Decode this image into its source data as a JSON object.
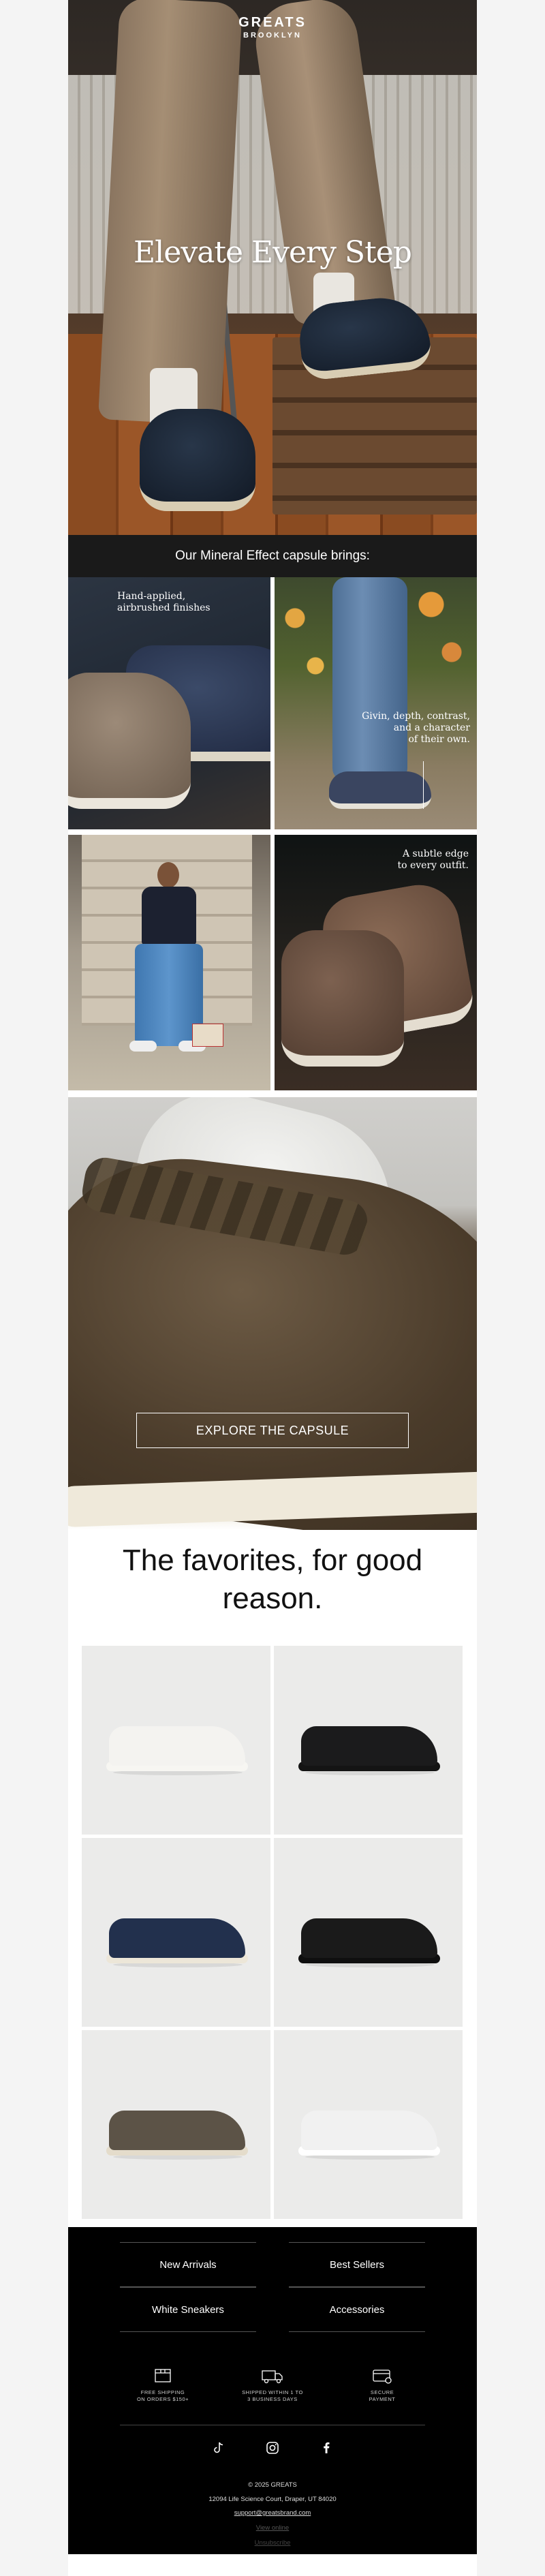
{
  "brand": {
    "line1": "GREATS",
    "line2": "BROOKLYN"
  },
  "hero": {
    "headline": "Elevate Every Step"
  },
  "capsule": {
    "intro": "Our Mineral Effect capsule brings:",
    "cards": [
      {
        "caption_line1": "Hand-applied,",
        "caption_line2": "airbrushed finishes"
      },
      {
        "caption_line1": "Givin, depth, contrast,",
        "caption_line2": "and a character",
        "caption_line3": "of their own."
      },
      {
        "caption_line1": "",
        "caption_line2": ""
      },
      {
        "caption_line1": "A subtle edge",
        "caption_line2": "to every outfit."
      }
    ]
  },
  "banner": {
    "cta": "EXPLORE THE CAPSULE"
  },
  "favorites": {
    "title_line1": "The favorites, for good",
    "title_line2": "reason.",
    "products": [
      {
        "color": "#f4f3f0",
        "sole": "#f7f6f2"
      },
      {
        "color": "#1b1b1c",
        "sole": "#141414"
      },
      {
        "color": "#22304d",
        "sole": "#ece6d8"
      },
      {
        "color": "#1a1a1a",
        "sole": "#0f0f0f"
      },
      {
        "color": "#5c5347",
        "sole": "#e4dccb"
      },
      {
        "color": "#f1f1f1",
        "sole": "#ffffff"
      }
    ]
  },
  "footer": {
    "nav": [
      "New Arrivals",
      "Best Sellers",
      "White Sneakers",
      "Accessories"
    ],
    "perks": [
      {
        "icon": "box-icon",
        "line1": "FREE SHIPPING",
        "line2": "ON ORDERS $150+"
      },
      {
        "icon": "truck-icon",
        "line1": "SHIPPED WITHIN 1 TO",
        "line2": "3 BUSINESS DAYS"
      },
      {
        "icon": "card-icon",
        "line1": "SECURE",
        "line2": "PAYMENT"
      }
    ],
    "social": [
      "tiktok-icon",
      "instagram-icon",
      "facebook-icon"
    ],
    "copyright": "© 2025 GREATS",
    "address": "12094 Life Science Court, Draper, UT 84020",
    "email": "support@greatsbrand.com",
    "link1": "View online",
    "link2": "Unsubscribe"
  },
  "colors": {
    "dark_strip": "#1a1a1a",
    "footer_bg": "#000000",
    "text_dark": "#111111"
  }
}
